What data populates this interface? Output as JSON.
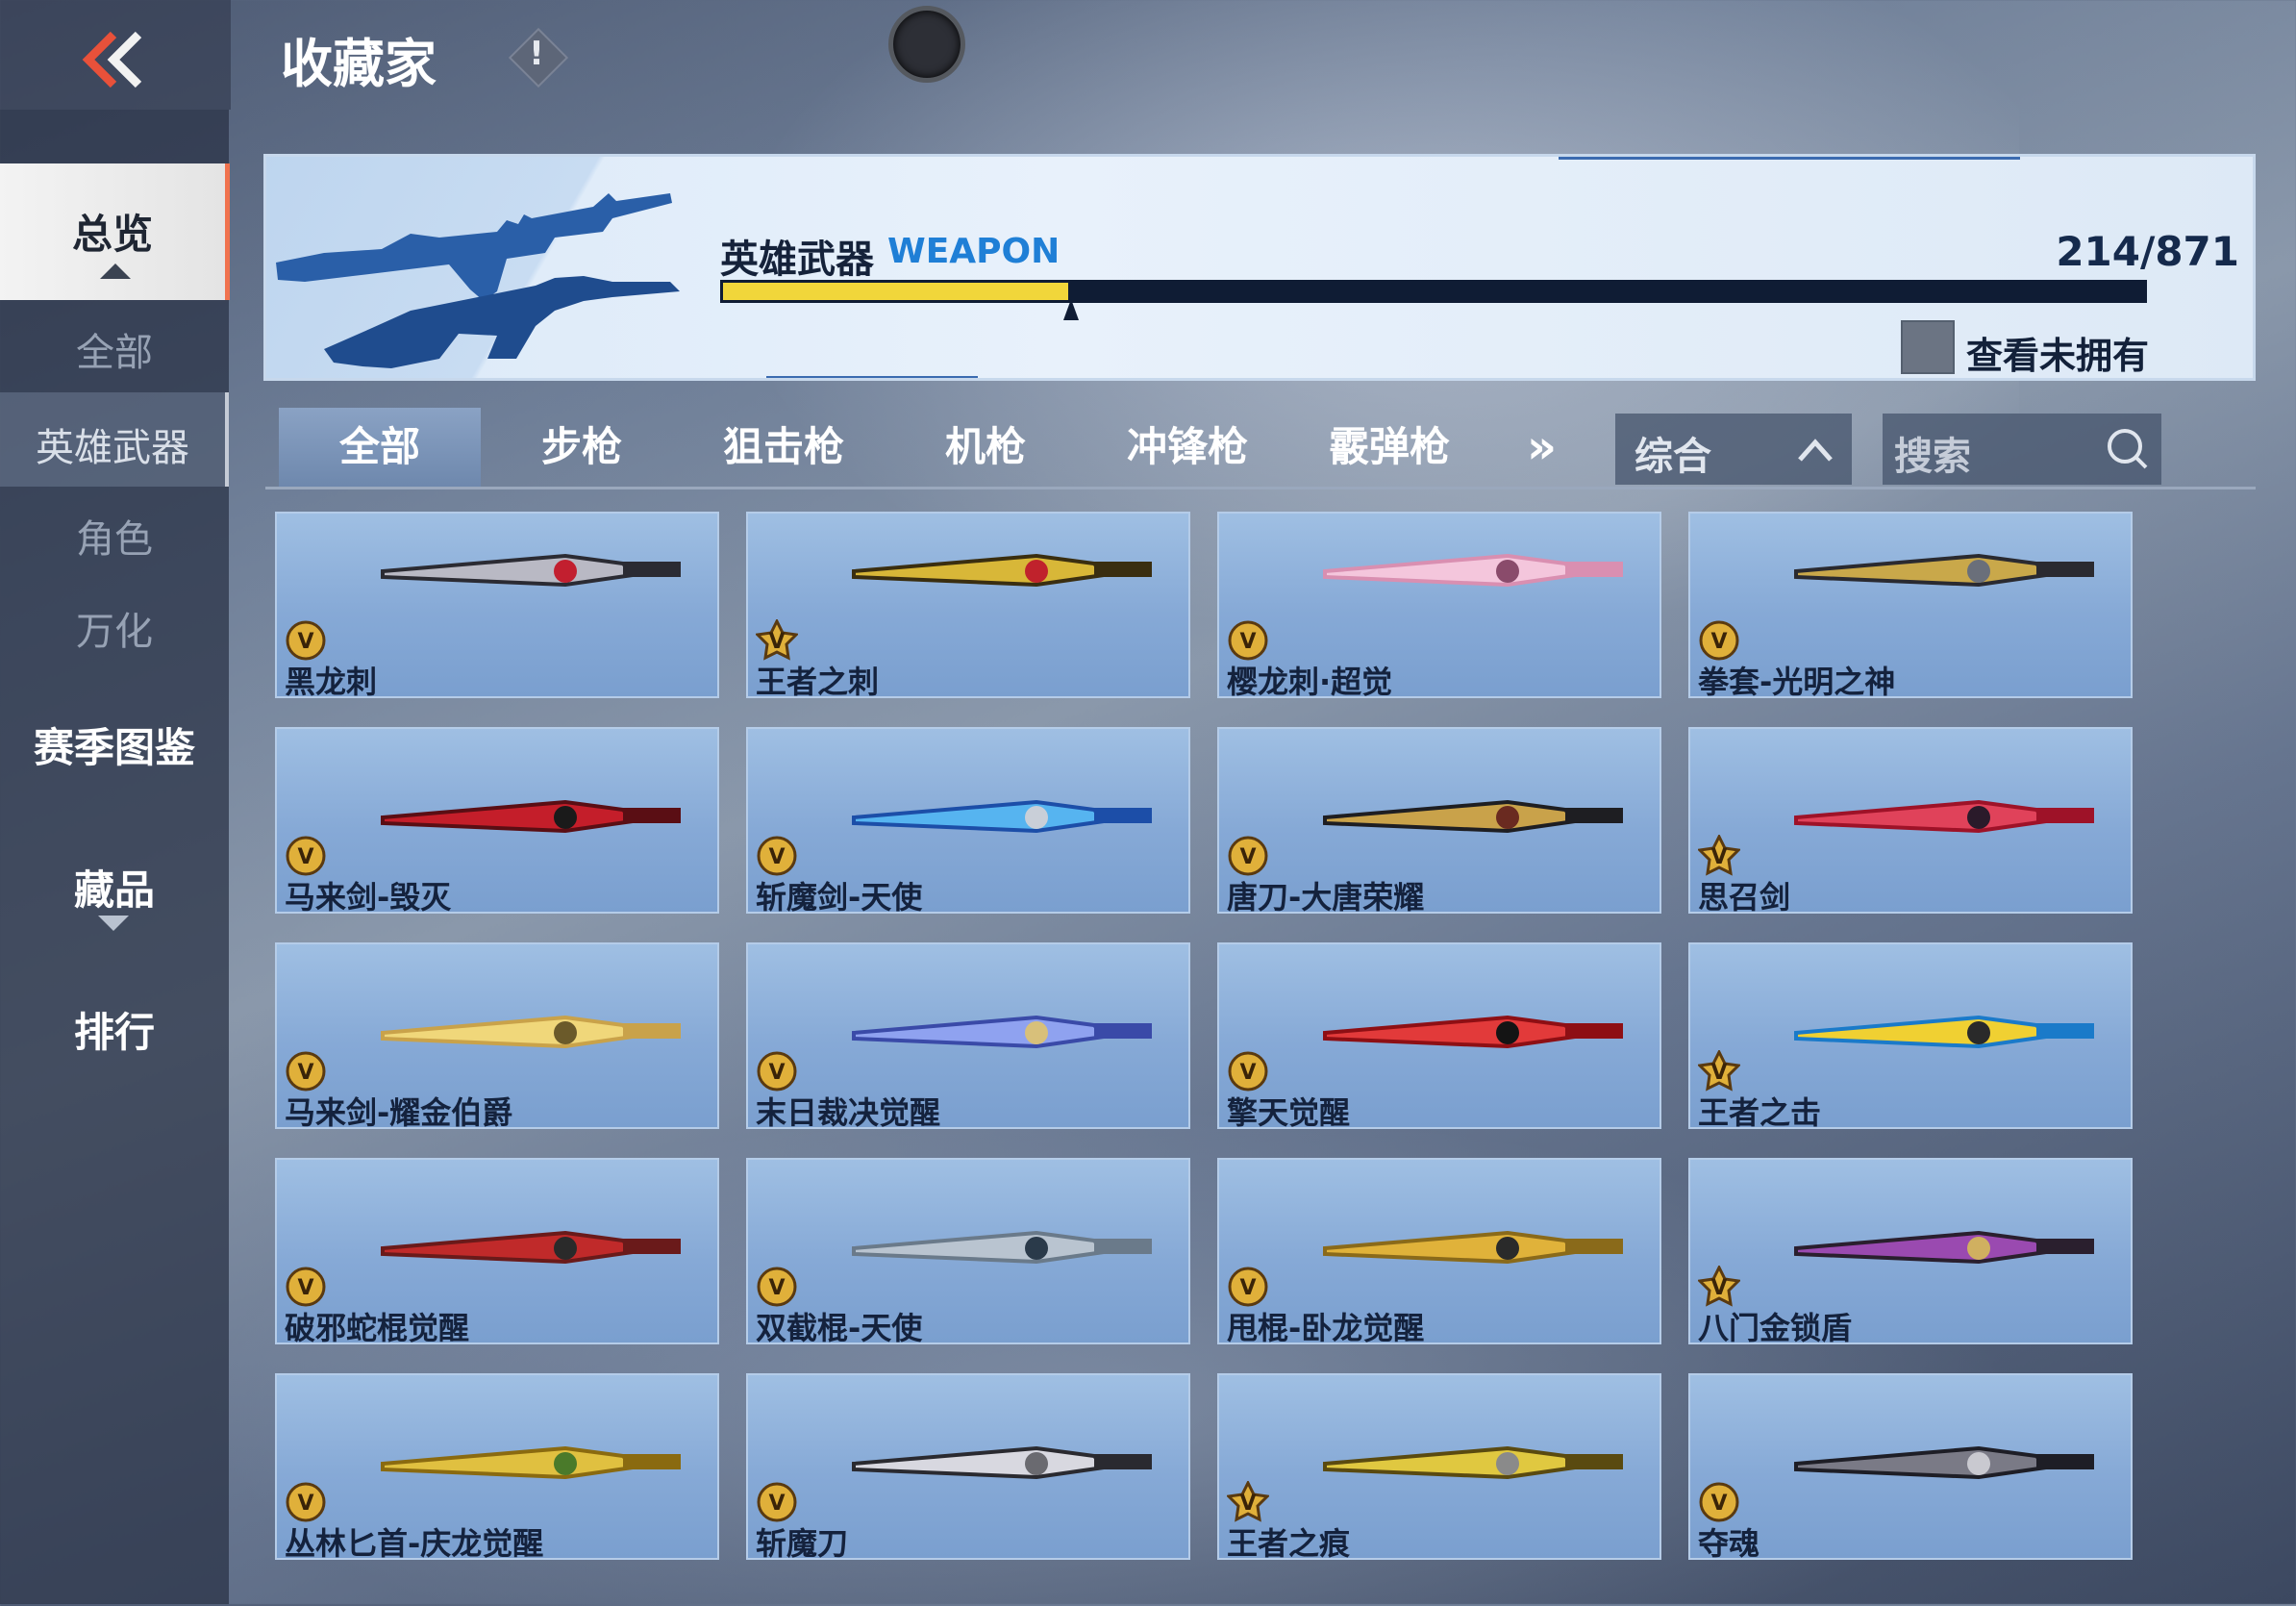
{
  "header": {
    "title": "收藏家",
    "back_icon": "double-chevron-left-icon",
    "info_glyph": "!"
  },
  "sidebar": {
    "items": [
      {
        "label": "总览",
        "state": "selected"
      },
      {
        "label": "全部",
        "state": "sub"
      },
      {
        "label": "英雄武器",
        "state": "sub-selected"
      },
      {
        "label": "角色",
        "state": "sub"
      },
      {
        "label": "万化",
        "state": "sub"
      },
      {
        "label": "赛季图鉴",
        "state": "normal"
      },
      {
        "label": "藏品",
        "state": "normal"
      },
      {
        "label": "排行",
        "state": "normal"
      }
    ]
  },
  "banner": {
    "title": "英雄武器",
    "title_en": "WEAPON",
    "count": "214/871",
    "progress": 0.246,
    "unowned_label": "查看未拥有",
    "unowned_checked": false
  },
  "tabs": {
    "items": [
      "全部",
      "步枪",
      "狙击枪",
      "机枪",
      "冲锋枪",
      "霰弹枪"
    ],
    "active_index": 0,
    "more_glyph": "»",
    "sort_label": "综合",
    "search_placeholder": "搜索"
  },
  "weapons": [
    {
      "name": "黑龙刺",
      "tier": "v"
    },
    {
      "name": "王者之刺",
      "tier": "king"
    },
    {
      "name": "樱龙刺·超觉",
      "tier": "v"
    },
    {
      "name": "拳套-光明之神",
      "tier": "v"
    },
    {
      "name": "马来剑-毁灭",
      "tier": "v"
    },
    {
      "name": "斩魔剑-天使",
      "tier": "v"
    },
    {
      "name": "唐刀-大唐荣耀",
      "tier": "v"
    },
    {
      "name": "思召剑",
      "tier": "king"
    },
    {
      "name": "马来剑-耀金伯爵",
      "tier": "v"
    },
    {
      "name": "末日裁决觉醒",
      "tier": "v"
    },
    {
      "name": "擎天觉醒",
      "tier": "v"
    },
    {
      "name": "王者之击",
      "tier": "king"
    },
    {
      "name": "破邪蛇棍觉醒",
      "tier": "v"
    },
    {
      "name": "双截棍-天使",
      "tier": "v"
    },
    {
      "name": "甩棍-卧龙觉醒",
      "tier": "v"
    },
    {
      "name": "八门金锁盾",
      "tier": "king"
    },
    {
      "name": "丛林匕首-庆龙觉醒",
      "tier": "v"
    },
    {
      "name": "斩魔刀",
      "tier": "v"
    },
    {
      "name": "王者之痕",
      "tier": "king"
    },
    {
      "name": "夺魂",
      "tier": "v"
    }
  ],
  "colors": {
    "accent": "#f0724e",
    "progress_fill": "#f1d63a",
    "banner_en": "#1f7fd6"
  }
}
